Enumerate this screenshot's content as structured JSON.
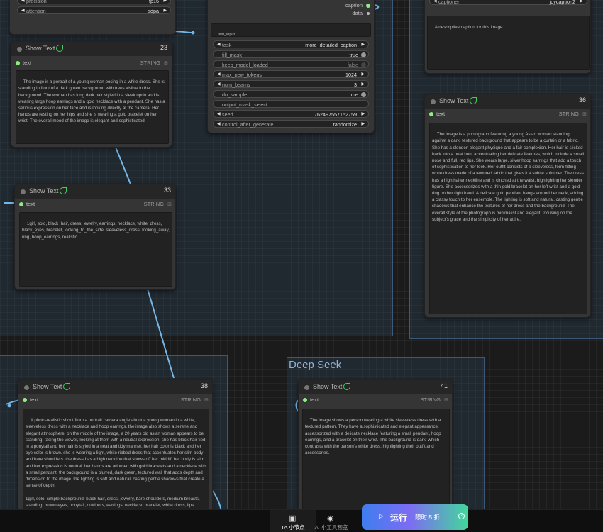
{
  "groups": {
    "deep_seek_title": "Deep Seek"
  },
  "top_left_node": {
    "widgets": [
      {
        "label": "precision",
        "value": "fp16"
      },
      {
        "label": "attention",
        "value": "sdpa"
      }
    ]
  },
  "caption_node": {
    "outputs": [
      "caption",
      "data"
    ],
    "text_input_label": "text_input",
    "widgets": [
      {
        "label": "task",
        "value": "more_detailed_caption"
      },
      {
        "label": "fill_mask",
        "value": "true"
      },
      {
        "label": "keep_model_loaded",
        "value": "false"
      },
      {
        "label": "max_new_tokens",
        "value": "1024"
      },
      {
        "label": "num_beams",
        "value": "3"
      },
      {
        "label": "do_sample",
        "value": "true"
      },
      {
        "label": "output_mask_select",
        "value": ""
      },
      {
        "label": "seed",
        "value": "762497557152759"
      },
      {
        "label": "control_after_generate",
        "value": "randomize"
      }
    ]
  },
  "joycaption_node": {
    "widget": {
      "label": "captioner",
      "value": "joycaption2"
    },
    "prompt": "A descriptive caption for this image"
  },
  "show_text_nodes": [
    {
      "title": "Show Text",
      "id": "23",
      "input": "text",
      "type": "STRING",
      "content": "The image is a portrait of a young woman posing in a white dress. She is standing in front of a dark green background with trees visible in the background. The woman has long dark hair styled in a sleek updo and is wearing large hoop earrings and a gold necklace with a pendant. She has a serious expression on her face and is looking directly at the camera. Her hands are resting on her hips and she is wearing a gold bracelet on her wrist. The overall mood of the image is elegant and sophisticated."
    },
    {
      "title": "Show Text",
      "id": "33",
      "input": "text",
      "type": "STRING",
      "content": "1girl, solo, black_hair, dress, jewelry, earrings, necklace, white_dress, black_eyes, bracelet, looking_to_the_side, sleeveless_dress, looking_away, ring, hoop_earrings, realistic"
    },
    {
      "title": "Show Text",
      "id": "36",
      "input": "text",
      "type": "STRING",
      "content": "The image is a photograph featuring a young Asian woman standing against a dark, textured background that appears to be a curtain or a fabric. She has a slender, elegant physique and a fair complexion. Her hair is slicked back into a neat bun, accentuating her delicate features, which include a small nose and full, red lips. She wears large, silver hoop earrings that add a touch of sophistication to her look. Her outfit consists of a sleeveless, form-fitting white dress made of a textured fabric that gives it a subtle shimmer. The dress has a high halter neckline and is cinched at the waist, highlighting her slender figure. She accessorizes with a thin gold bracelet on her left wrist and a gold ring on her right hand. A delicate gold pendant hangs around her neck, adding a classy touch to her ensemble. The lighting is soft and natural, casting gentle shadows that enhance the textures of her dress and the background. The overall style of the photograph is minimalist and elegant, focusing on the subject's grace and the simplicity of her attire."
    },
    {
      "title": "Show Text",
      "id": "38",
      "input": "text",
      "type": "STRING",
      "content": "A photo-realistic shoot from a portrait camera angle about a young woman in a white, sleeveless dress with a necklace and hoop earrings. the image also shows a serene and elegant atmosphere. on the middle of the image, a 20 years old asian woman appears to be standing, facing the viewer, looking at them with a neutral expression. she has black hair tied in a ponytail and her hair is styled in a neat and tidy manner. her hair color is black and her eye color is brown. she is wearing a light, white ribbed dress that accentuates her slim body and bare shoulders. the dress has a high neckline that shows off her midriff. her body is slim and her expression is neutral. her hands are adorned with gold bracelets and a necklace with a small pendant. the background is a blurred, dark green, textured wall that adds depth and dimension to the image. the lighting is soft and natural, casting gentle shadows that create a sense of depth.\n\n1girl, solo, simple background, black hair, dress, jewelry, bare shoulders, medium breasts, standing, brown eyes, ponytail, outdoors, earrings, necklace, bracelet, white dress, lips"
    },
    {
      "title": "Show Text",
      "id": "41",
      "input": "text",
      "type": "STRING",
      "content": "The image shows a person wearing a white sleeveless dress with a textured pattern. They have a sophisticated and elegant appearance, accessorized with a delicate necklace featuring a small pendant, hoop earrings, and a bracelet on their wrist. The background is dark, which contrasts with the person's white dress, highlighting their outfit and accessories."
    }
  ],
  "bottom_bar": {
    "tabs": [
      {
        "label": "TA 小节点",
        "icon": "node-icon"
      },
      {
        "label": "AI 小工具预览",
        "icon": "eye-icon"
      }
    ],
    "run_button": {
      "label": "运行",
      "sub": "限时 5 折",
      "help": "?"
    }
  },
  "colors": {
    "link": "#74b6e6",
    "group_border": "#3c5a78",
    "connected_dot": "#8cf080",
    "run_gradient": [
      "#3e7ef0",
      "#7d6cf2",
      "#42d89b"
    ]
  }
}
